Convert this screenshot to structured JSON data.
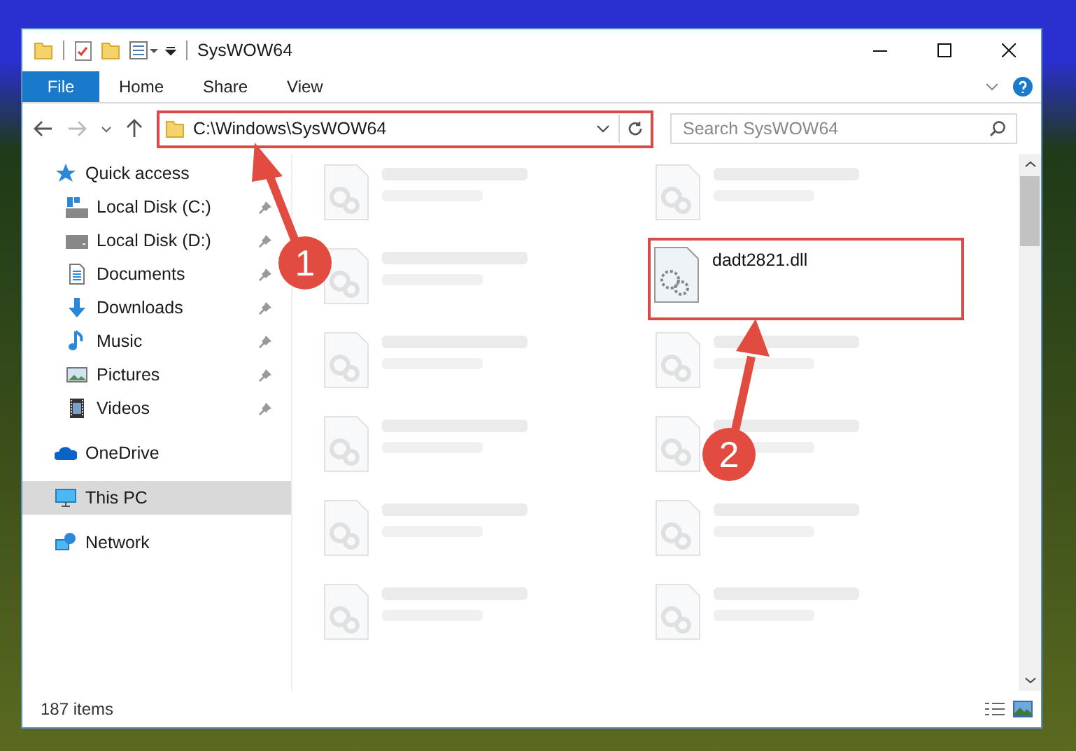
{
  "window": {
    "title": "SysWOW64"
  },
  "ribbon_tabs": [
    {
      "label": "File",
      "kind": "file"
    },
    {
      "label": "Home",
      "kind": "tab"
    },
    {
      "label": "Share",
      "kind": "tab"
    },
    {
      "label": "View",
      "kind": "tab"
    }
  ],
  "address_bar": {
    "path": "C:\\Windows\\SysWOW64",
    "highlighted": true
  },
  "search": {
    "placeholder": "Search SysWOW64"
  },
  "navigation": [
    {
      "label": "Quick access",
      "kind": "star",
      "selected": false,
      "children": [
        {
          "label": "Local Disk (C:)",
          "kind": "system-drive",
          "pinned": true,
          "selected": false
        },
        {
          "label": "Local Disk (D:)",
          "kind": "drive",
          "pinned": true,
          "selected": false
        },
        {
          "label": "Documents",
          "kind": "document",
          "pinned": true,
          "selected": false
        },
        {
          "label": "Downloads",
          "kind": "download",
          "pinned": true,
          "selected": false
        },
        {
          "label": "Music",
          "kind": "music",
          "pinned": true,
          "selected": false
        },
        {
          "label": "Pictures",
          "kind": "pictures",
          "pinned": true,
          "selected": false
        },
        {
          "label": "Videos",
          "kind": "videos",
          "pinned": true,
          "selected": false
        }
      ]
    },
    {
      "label": "OneDrive",
      "kind": "cloud",
      "selected": false
    },
    {
      "label": "This PC",
      "kind": "computer",
      "selected": true
    },
    {
      "label": "Network",
      "kind": "network",
      "selected": false
    }
  ],
  "files": [
    {
      "kind": "blurred"
    },
    {
      "kind": "blurred"
    },
    {
      "kind": "blurred"
    },
    {
      "kind": "file",
      "name": "dadt2821.dll",
      "highlighted": true
    },
    {
      "kind": "blurred"
    },
    {
      "kind": "blurred"
    },
    {
      "kind": "blurred"
    },
    {
      "kind": "blurred"
    },
    {
      "kind": "blurred"
    },
    {
      "kind": "blurred"
    },
    {
      "kind": "blurred"
    },
    {
      "kind": "blurred"
    }
  ],
  "status_bar": {
    "item_count": "187 items"
  },
  "callouts": [
    {
      "label": "1"
    },
    {
      "label": "2"
    }
  ]
}
